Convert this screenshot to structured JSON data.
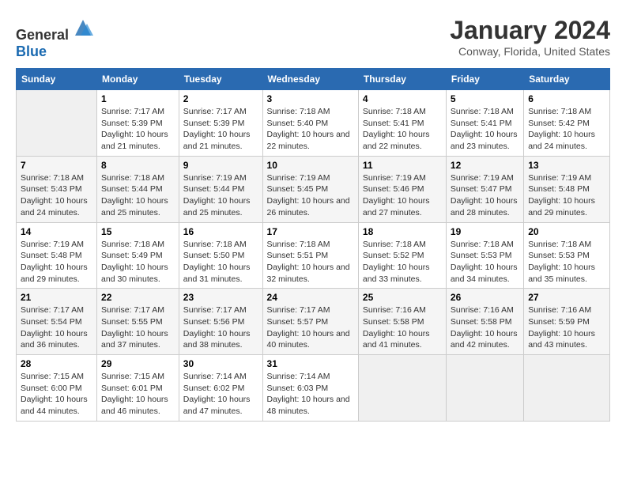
{
  "logo": {
    "text_general": "General",
    "text_blue": "Blue"
  },
  "title": "January 2024",
  "subtitle": "Conway, Florida, United States",
  "days_of_week": [
    "Sunday",
    "Monday",
    "Tuesday",
    "Wednesday",
    "Thursday",
    "Friday",
    "Saturday"
  ],
  "weeks": [
    [
      {
        "num": "",
        "info": ""
      },
      {
        "num": "1",
        "info": "Sunrise: 7:17 AM\nSunset: 5:39 PM\nDaylight: 10 hours\nand 21 minutes."
      },
      {
        "num": "2",
        "info": "Sunrise: 7:17 AM\nSunset: 5:39 PM\nDaylight: 10 hours\nand 21 minutes."
      },
      {
        "num": "3",
        "info": "Sunrise: 7:18 AM\nSunset: 5:40 PM\nDaylight: 10 hours\nand 22 minutes."
      },
      {
        "num": "4",
        "info": "Sunrise: 7:18 AM\nSunset: 5:41 PM\nDaylight: 10 hours\nand 22 minutes."
      },
      {
        "num": "5",
        "info": "Sunrise: 7:18 AM\nSunset: 5:41 PM\nDaylight: 10 hours\nand 23 minutes."
      },
      {
        "num": "6",
        "info": "Sunrise: 7:18 AM\nSunset: 5:42 PM\nDaylight: 10 hours\nand 24 minutes."
      }
    ],
    [
      {
        "num": "7",
        "info": "Sunrise: 7:18 AM\nSunset: 5:43 PM\nDaylight: 10 hours\nand 24 minutes."
      },
      {
        "num": "8",
        "info": "Sunrise: 7:18 AM\nSunset: 5:44 PM\nDaylight: 10 hours\nand 25 minutes."
      },
      {
        "num": "9",
        "info": "Sunrise: 7:19 AM\nSunset: 5:44 PM\nDaylight: 10 hours\nand 25 minutes."
      },
      {
        "num": "10",
        "info": "Sunrise: 7:19 AM\nSunset: 5:45 PM\nDaylight: 10 hours\nand 26 minutes."
      },
      {
        "num": "11",
        "info": "Sunrise: 7:19 AM\nSunset: 5:46 PM\nDaylight: 10 hours\nand 27 minutes."
      },
      {
        "num": "12",
        "info": "Sunrise: 7:19 AM\nSunset: 5:47 PM\nDaylight: 10 hours\nand 28 minutes."
      },
      {
        "num": "13",
        "info": "Sunrise: 7:19 AM\nSunset: 5:48 PM\nDaylight: 10 hours\nand 29 minutes."
      }
    ],
    [
      {
        "num": "14",
        "info": "Sunrise: 7:19 AM\nSunset: 5:48 PM\nDaylight: 10 hours\nand 29 minutes."
      },
      {
        "num": "15",
        "info": "Sunrise: 7:18 AM\nSunset: 5:49 PM\nDaylight: 10 hours\nand 30 minutes."
      },
      {
        "num": "16",
        "info": "Sunrise: 7:18 AM\nSunset: 5:50 PM\nDaylight: 10 hours\nand 31 minutes."
      },
      {
        "num": "17",
        "info": "Sunrise: 7:18 AM\nSunset: 5:51 PM\nDaylight: 10 hours\nand 32 minutes."
      },
      {
        "num": "18",
        "info": "Sunrise: 7:18 AM\nSunset: 5:52 PM\nDaylight: 10 hours\nand 33 minutes."
      },
      {
        "num": "19",
        "info": "Sunrise: 7:18 AM\nSunset: 5:53 PM\nDaylight: 10 hours\nand 34 minutes."
      },
      {
        "num": "20",
        "info": "Sunrise: 7:18 AM\nSunset: 5:53 PM\nDaylight: 10 hours\nand 35 minutes."
      }
    ],
    [
      {
        "num": "21",
        "info": "Sunrise: 7:17 AM\nSunset: 5:54 PM\nDaylight: 10 hours\nand 36 minutes."
      },
      {
        "num": "22",
        "info": "Sunrise: 7:17 AM\nSunset: 5:55 PM\nDaylight: 10 hours\nand 37 minutes."
      },
      {
        "num": "23",
        "info": "Sunrise: 7:17 AM\nSunset: 5:56 PM\nDaylight: 10 hours\nand 38 minutes."
      },
      {
        "num": "24",
        "info": "Sunrise: 7:17 AM\nSunset: 5:57 PM\nDaylight: 10 hours\nand 40 minutes."
      },
      {
        "num": "25",
        "info": "Sunrise: 7:16 AM\nSunset: 5:58 PM\nDaylight: 10 hours\nand 41 minutes."
      },
      {
        "num": "26",
        "info": "Sunrise: 7:16 AM\nSunset: 5:58 PM\nDaylight: 10 hours\nand 42 minutes."
      },
      {
        "num": "27",
        "info": "Sunrise: 7:16 AM\nSunset: 5:59 PM\nDaylight: 10 hours\nand 43 minutes."
      }
    ],
    [
      {
        "num": "28",
        "info": "Sunrise: 7:15 AM\nSunset: 6:00 PM\nDaylight: 10 hours\nand 44 minutes."
      },
      {
        "num": "29",
        "info": "Sunrise: 7:15 AM\nSunset: 6:01 PM\nDaylight: 10 hours\nand 46 minutes."
      },
      {
        "num": "30",
        "info": "Sunrise: 7:14 AM\nSunset: 6:02 PM\nDaylight: 10 hours\nand 47 minutes."
      },
      {
        "num": "31",
        "info": "Sunrise: 7:14 AM\nSunset: 6:03 PM\nDaylight: 10 hours\nand 48 minutes."
      },
      {
        "num": "",
        "info": ""
      },
      {
        "num": "",
        "info": ""
      },
      {
        "num": "",
        "info": ""
      }
    ]
  ]
}
